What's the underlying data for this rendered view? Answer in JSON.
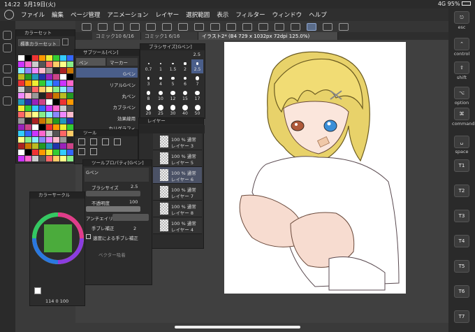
{
  "status": {
    "time": "14:22",
    "date": "5月19日(火)",
    "network": "4G",
    "battery": "95%"
  },
  "menu": [
    "ファイル",
    "編集",
    "ページ管理",
    "アニメーション",
    "レイヤー",
    "選択範囲",
    "表示",
    "フィルター",
    "ウィンドウ",
    "ヘルプ"
  ],
  "tabs": {
    "comic": "コミック10 6/16",
    "comic2": "コミック1 6/16",
    "illust": "イラスト2* (B4 729 x 1032px 72dpi 125.0%)"
  },
  "color_set": {
    "title": "カラーセット",
    "preset": "標準カラーセット"
  },
  "sub_tool": {
    "title": "サブツール[ペン]",
    "tab_pen": "ペン",
    "tab_marker": "マーカー",
    "items": [
      "Gペン",
      "リアルGペン",
      "丸ペン",
      "カブラペン",
      "効果線用",
      "カリグラフィ"
    ]
  },
  "brush_size_panel": {
    "title": "ブラシサイズ[Gペン]",
    "current": "2.5",
    "sizes": [
      "0.7",
      "1",
      "1.5",
      "2",
      "2.5",
      "3",
      "4",
      "5",
      "6",
      "7",
      "8",
      "10",
      "12",
      "15",
      "17",
      "20",
      "25",
      "30",
      "40",
      "50"
    ]
  },
  "tool_panel": {
    "title": "ツール"
  },
  "tool_property": {
    "title": "ツールプロパティ[Gペン]",
    "brush_name": "Gペン",
    "brush_size_label": "ブラシサイズ",
    "brush_size_value": "2.5",
    "opacity_label": "不透明度",
    "opacity_value": "100",
    "antialias_label": "アンチエイリ",
    "stabilization_label": "手ブレ補正",
    "stabilization_value": "2",
    "speed_label": "速度による手ブレ補正",
    "vector_label": "ベクター吸着"
  },
  "layers": {
    "title": "レイヤー",
    "rows": [
      {
        "mode": "100 % 通常",
        "name": "レイヤー 3"
      },
      {
        "mode": "100 % 通常",
        "name": "レイヤー 5"
      },
      {
        "mode": "100 % 通常",
        "name": "レイヤー 6"
      },
      {
        "mode": "100 % 通常",
        "name": "レイヤー 7"
      },
      {
        "mode": "100 % 通常",
        "name": "レイヤー 8"
      },
      {
        "mode": "100 % 通常",
        "name": "レイヤー 4"
      }
    ]
  },
  "color_circle": {
    "title": "カラーサークル",
    "v1": "114",
    "v2": "0",
    "v3": "100"
  },
  "right_keys": [
    "esc",
    "control",
    "shift",
    "option",
    "command",
    "space",
    "T1",
    "T2",
    "T3",
    "T4",
    "T5",
    "T6",
    "T7"
  ],
  "colors": {
    "accent": "#4a5e8a",
    "bg": "#3a3a3a",
    "panel": "#2c2c2c"
  }
}
